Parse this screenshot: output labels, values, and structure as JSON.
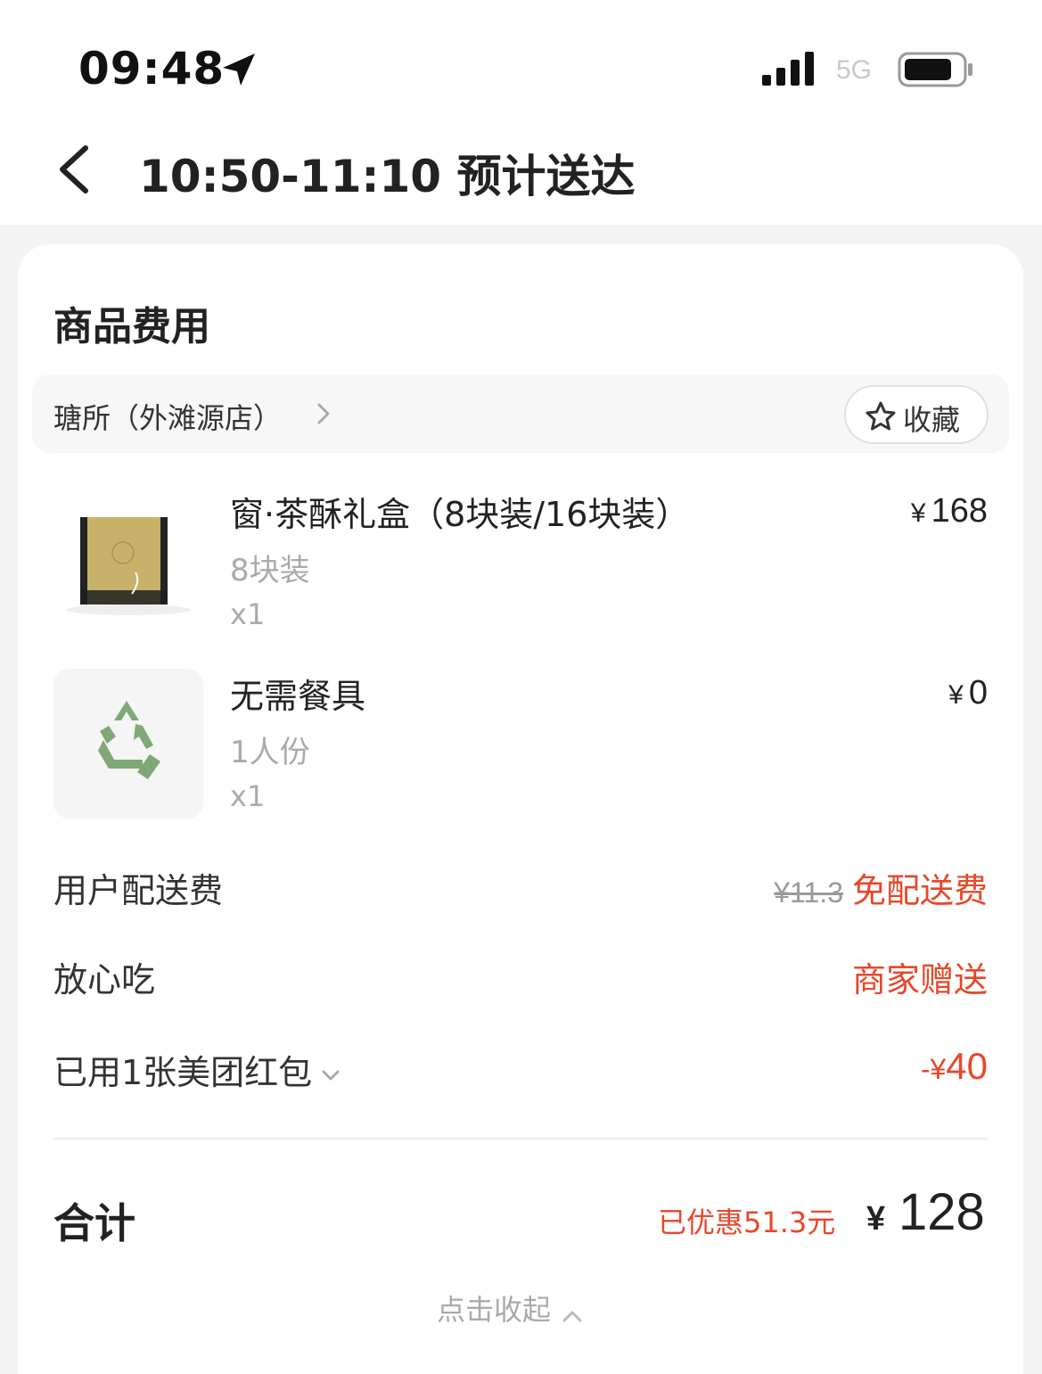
{
  "status_bar": {
    "time": "09:48",
    "network": "5G"
  },
  "header": {
    "title": "10:50-11:10 预计送达"
  },
  "card": {
    "section_title": "商品费用",
    "shop": {
      "name": "瑭所（外滩源店）",
      "favorite_label": "收藏"
    },
    "items": [
      {
        "name": "窗·茶酥礼盒（8块装/16块装）",
        "spec": "8块装",
        "qty": "x1",
        "price_symbol": "¥",
        "price": "168"
      },
      {
        "name": "无需餐具",
        "spec": "1人份",
        "qty": "x1",
        "price_symbol": "¥",
        "price": "0"
      }
    ],
    "fees": {
      "delivery": {
        "label": "用户配送费",
        "original": "¥11.3",
        "value": "免配送费"
      },
      "assurance": {
        "label": "放心吃",
        "value": "商家赠送"
      },
      "coupon": {
        "label": "已用1张美团红包",
        "prefix": "-¥",
        "value": "40"
      }
    },
    "total": {
      "label": "合计",
      "saved": "已优惠51.3元",
      "symbol": "¥",
      "amount": "128"
    },
    "collapse_label": "点击收起"
  },
  "colors": {
    "accent_red": "#e8472a",
    "muted_text": "#aaaaaa",
    "recycle_green": "#7fa876"
  },
  "icons": [
    "location-arrow-icon",
    "signal-icon",
    "battery-icon",
    "back-chevron-icon",
    "chevron-right-icon",
    "star-icon",
    "chevron-down-icon",
    "chevron-up-icon",
    "recycle-icon"
  ]
}
